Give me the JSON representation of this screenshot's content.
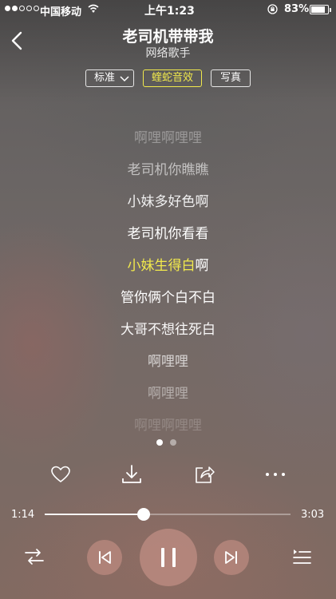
{
  "status_bar": {
    "carrier": "中国移动",
    "time": "上午1:23",
    "battery_percent": "83%",
    "battery_level": 0.83,
    "signal_strength": 2
  },
  "header": {
    "title": "老司机带带我",
    "artist": "网络歌手"
  },
  "tags": {
    "quality": "标准",
    "effect": "蝰蛇音效",
    "photo": "写真"
  },
  "lyrics": {
    "lines": [
      "啊哩啊哩哩",
      "老司机你瞧瞧",
      "小妹多好色啊",
      "老司机你看看",
      "小妹生得白啊",
      "管你俩个白不白",
      "大哥不想往死白",
      "啊哩哩",
      "啊哩哩",
      "啊哩啊哩哩"
    ],
    "current_sung": "小妹生得白",
    "current_rest": "啊"
  },
  "pager": {
    "count": 2,
    "active": 0
  },
  "actions": [
    "heart-icon",
    "download-icon",
    "share-icon",
    "more-icon"
  ],
  "progress": {
    "elapsed": "1:14",
    "total": "3:03",
    "fraction": 0.404
  },
  "controls": [
    "shuffle-icon",
    "previous-icon",
    "pause-icon",
    "next-icon",
    "playlist-icon"
  ],
  "colors": {
    "accent": "#f1e94c",
    "text": "#ffffff"
  }
}
